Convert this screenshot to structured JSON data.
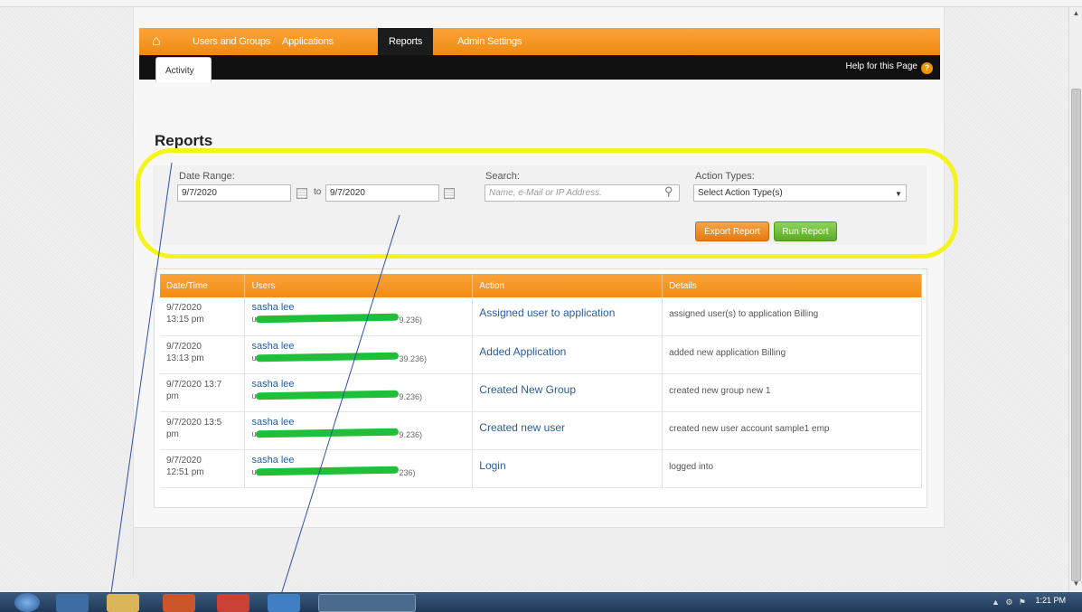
{
  "nav": {
    "items": [
      "Users and Groups",
      "Applications",
      "Reports",
      "Admin Settings"
    ],
    "active": "Reports"
  },
  "subnav": {
    "tab": "Activity",
    "help": "Help for this Page"
  },
  "page_title": "Reports",
  "filters": {
    "date_range_label": "Date Range:",
    "date_from": "9/7/2020",
    "to_label": "to",
    "date_to": "9/7/2020",
    "search_label": "Search:",
    "search_placeholder": "Name, e-Mail or IP Address.",
    "action_types_label": "Action Types:",
    "action_types_value": "Select Action Type(s)",
    "export_button": "Export Report",
    "run_button": "Run Report"
  },
  "table": {
    "headers": [
      "Date/Time",
      "Users",
      "Action",
      "Details"
    ],
    "rows": [
      {
        "date": "9/7/2020",
        "time": "13:15 pm",
        "user": "sasha lee",
        "user_sub_prefix": "u",
        "user_sub_suffix": "9.236)",
        "action": "Assigned user to application",
        "details": "assigned user(s) to application Billing"
      },
      {
        "date": "9/7/2020",
        "time": "13:13 pm",
        "user": "sasha lee",
        "user_sub_prefix": "u",
        "user_sub_suffix": "39.236)",
        "action": "Added Application",
        "details": "added new application Billing"
      },
      {
        "date": "9/7/2020 13:7",
        "time": "pm",
        "user": "sasha lee",
        "user_sub_prefix": "u",
        "user_sub_suffix": "9.236)",
        "action": "Created New Group",
        "details": "created new group new 1"
      },
      {
        "date": "9/7/2020 13:5",
        "time": "pm",
        "user": "sasha lee",
        "user_sub_prefix": "ura",
        "user_sub_suffix": "9.236)",
        "action": "Created new user",
        "details": "created new user account sample1 emp"
      },
      {
        "date": "9/7/2020",
        "time": "12:51 pm",
        "user": "sasha lee",
        "user_sub_prefix": "ura",
        "user_sub_suffix": "236)",
        "action": "Login",
        "details": "logged into"
      }
    ]
  },
  "taskbar": {
    "clock": "1:21 PM"
  },
  "colors": {
    "nav_orange": "#f08a10",
    "highlight_yellow": "#f4f41a",
    "redaction_green": "#1fbf3a",
    "link_blue": "#2a5d9b",
    "run_green": "#5aab22"
  }
}
